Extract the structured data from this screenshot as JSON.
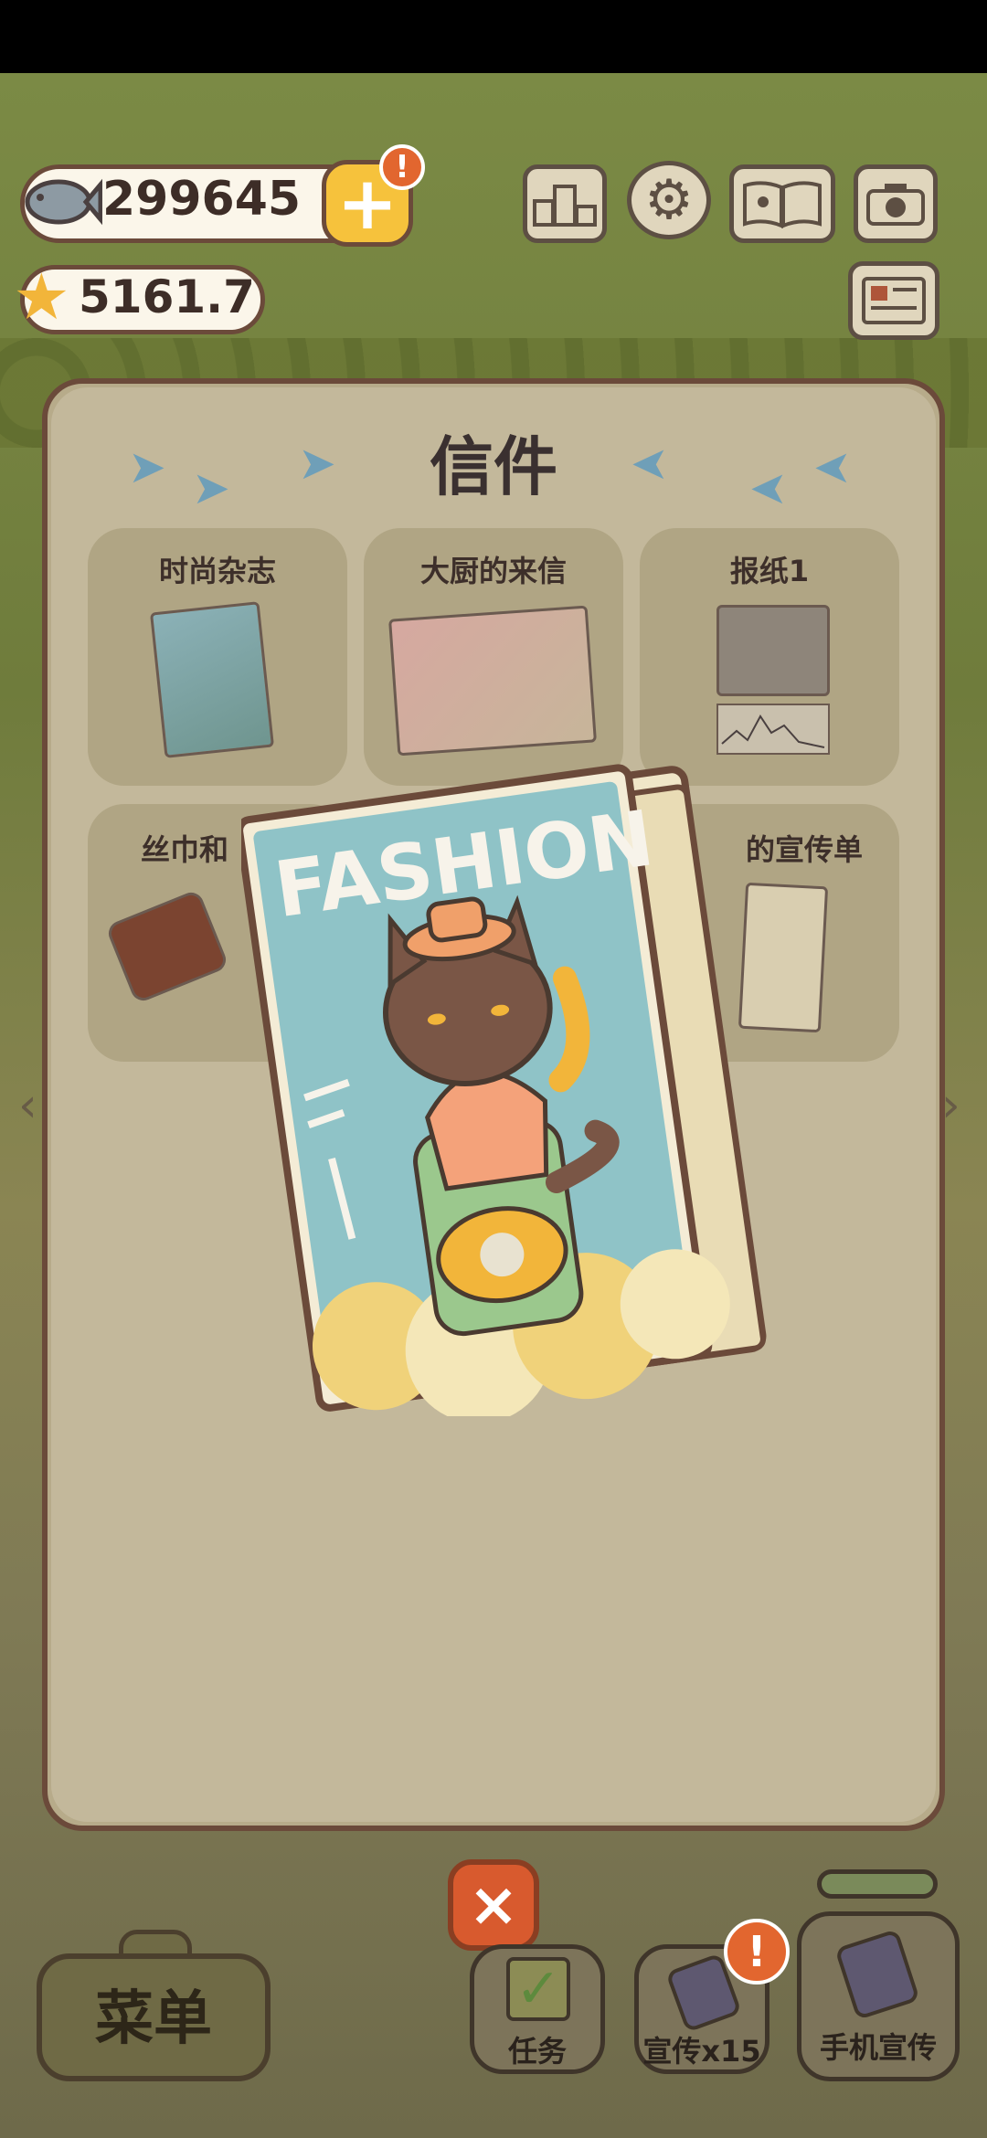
{
  "currency": {
    "fish": "299645",
    "stars": "5161.7",
    "alert_mark": "!"
  },
  "top_icons": [
    "ranking-icon",
    "settings-icon",
    "book-icon",
    "camera-icon",
    "news-icon"
  ],
  "panel": {
    "title": "信件",
    "items": [
      {
        "label": "时尚杂志",
        "icon": "fashion-magazine-icon"
      },
      {
        "label": "大厨的来信",
        "icon": "chef-letter-icon"
      },
      {
        "label": "报纸1",
        "icon": "newspaper-icon"
      },
      {
        "label": "丝巾和",
        "icon": "scarf-icon"
      },
      {
        "label": "的宣传单",
        "icon": "flyer-icon"
      }
    ]
  },
  "featured": {
    "title": "FASHION",
    "icon": "fashion-magazine-cover"
  },
  "bottom_bar": {
    "close_label": "×",
    "menu_label": "菜单",
    "tasks_label": "任务",
    "promo_label": "宣传x15",
    "phone_label": "手机宣传",
    "promo_alert": "!"
  },
  "colors": {
    "accent": "#f6c23c",
    "alert": "#e2662f",
    "close": "#d85a2e",
    "panel": "#c3b89b"
  }
}
